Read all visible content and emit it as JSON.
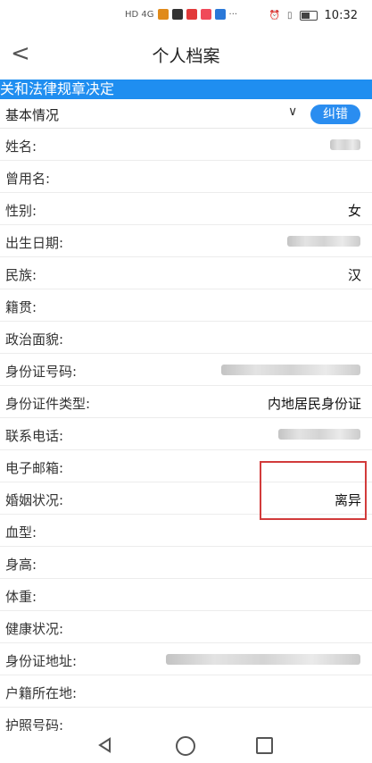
{
  "status_bar": {
    "network_text": "HD 4G",
    "time": "10:32",
    "ellipsis": "···",
    "icons": [
      "signal-icon",
      "app-icon",
      "app-icon",
      "app-icon",
      "app-icon",
      "app-icon",
      "alarm-icon",
      "vibrate-icon",
      "battery-icon"
    ]
  },
  "header": {
    "back_label": "<",
    "title": "个人档案"
  },
  "banner": {
    "text": "关和法律规章决定"
  },
  "section": {
    "label": "基本情况",
    "correct_button": "纠错"
  },
  "fields": [
    {
      "label": "姓名:",
      "value": "",
      "blurred": true
    },
    {
      "label": "曾用名:",
      "value": ""
    },
    {
      "label": "性别:",
      "value": "女"
    },
    {
      "label": "出生日期:",
      "value": "",
      "blurred": true
    },
    {
      "label": "民族:",
      "value": "汉"
    },
    {
      "label": "籍贯:",
      "value": ""
    },
    {
      "label": "政治面貌:",
      "value": ""
    },
    {
      "label": "身份证号码:",
      "value": "",
      "blurred": true
    },
    {
      "label": "身份证件类型:",
      "value": "内地居民身份证"
    },
    {
      "label": "联系电话:",
      "value": "",
      "blurred": true
    },
    {
      "label": "电子邮箱:",
      "value": ""
    },
    {
      "label": "婚姻状况:",
      "value": "离异"
    },
    {
      "label": "血型:",
      "value": ""
    },
    {
      "label": "身高:",
      "value": ""
    },
    {
      "label": "体重:",
      "value": ""
    },
    {
      "label": "健康状况:",
      "value": ""
    },
    {
      "label": "身份证地址:",
      "value": "",
      "blurred": true
    },
    {
      "label": "户籍所在地:",
      "value": ""
    },
    {
      "label": "护照号码:",
      "value": ""
    }
  ],
  "colors": {
    "accent": "#1f8ef0",
    "highlight": "#d23b3b"
  }
}
